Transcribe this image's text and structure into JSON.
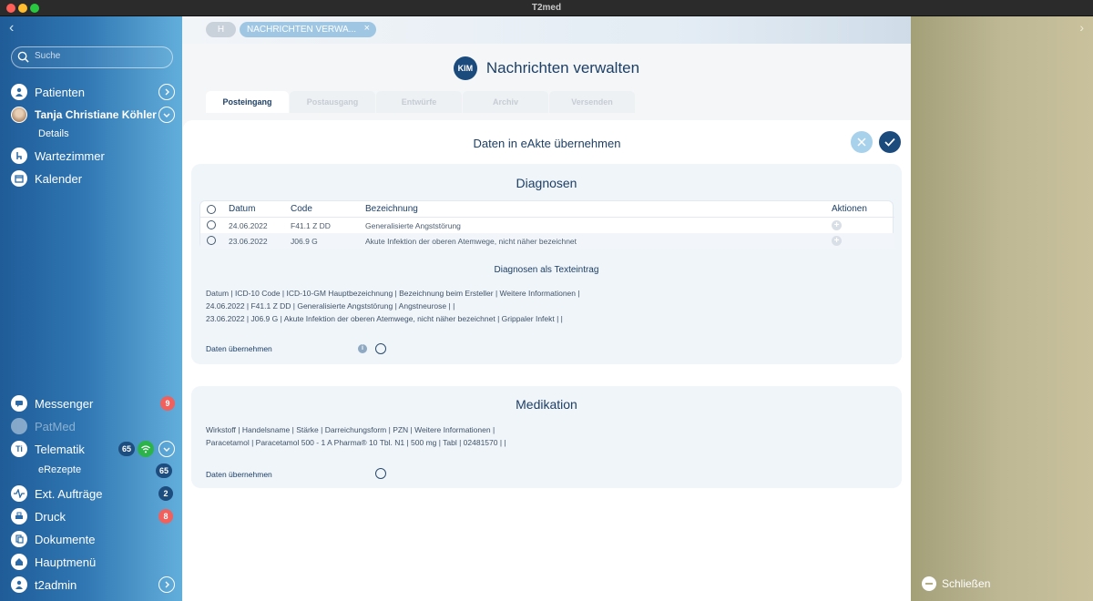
{
  "window": {
    "title": "T2med"
  },
  "sidebar": {
    "search_placeholder": "Suche",
    "items": {
      "patienten": {
        "label": "Patienten"
      },
      "patient": {
        "label": "Tanja Christiane Köhler"
      },
      "details": {
        "label": "Details"
      },
      "wartezimmer": {
        "label": "Wartezimmer"
      },
      "kalender": {
        "label": "Kalender"
      },
      "messenger": {
        "label": "Messenger",
        "badge": "9"
      },
      "patmed": {
        "label": "PatMed"
      },
      "telematik": {
        "label": "Telematik",
        "badge": "65"
      },
      "erezepte": {
        "label": "eRezepte",
        "badge": "65"
      },
      "auftraege": {
        "label": "Ext. Aufträge",
        "badge": "2"
      },
      "druck": {
        "label": "Druck",
        "badge": "8"
      },
      "dokumente": {
        "label": "Dokumente"
      },
      "hauptmenue": {
        "label": "Hauptmenü"
      },
      "user": {
        "label": "t2admin"
      }
    }
  },
  "top_tabs": {
    "home": "H",
    "active": "NACHRICHTEN VERWA..."
  },
  "header": {
    "logo": "KIM",
    "title": "Nachrichten verwalten"
  },
  "sub_tabs": [
    "Posteingang",
    "Postausgang",
    "Entwürfe",
    "Archiv",
    "Versenden"
  ],
  "dialog": {
    "title": "Daten in eAkte übernehmen",
    "diagnosen": {
      "title": "Diagnosen",
      "columns": [
        "Datum",
        "Code",
        "Bezeichnung",
        "Aktionen"
      ],
      "rows": [
        {
          "datum": "24.06.2022",
          "code": "F41.1 Z DD",
          "bezeichnung": "Generalisierte Angststörung"
        },
        {
          "datum": "23.06.2022",
          "code": "J06.9 G",
          "bezeichnung": "Akute Infektion der oberen Atemwege, nicht näher bezeichnet"
        }
      ],
      "text_heading": "Diagnosen als Texteintrag",
      "text_lines": [
        "Datum | ICD-10 Code | ICD-10-GM Hauptbezeichnung | Bezeichnung beim Ersteller | Weitere Informationen |",
        "24.06.2022 | F41.1 Z DD | Generalisierte Angststörung | Angstneurose |  |",
        "23.06.2022 | J06.9 G | Akute Infektion der oberen Atemwege, nicht näher bezeichnet | Grippaler Infekt |  |"
      ],
      "take_label": "Daten übernehmen"
    },
    "medikation": {
      "title": "Medikation",
      "text_lines": [
        "Wirkstoff | Handelsname | Stärke | Darreichungsform | PZN | Weitere Informationen |",
        "Paracetamol | Paracetamol 500 - 1 A Pharma® 10 Tbl. N1 | 500 mg | Tabl | 02481570 |  |"
      ],
      "take_label": "Daten übernehmen"
    }
  },
  "right_pane": {
    "close_label": "Schließen"
  },
  "colors": {
    "accent": "#1b4a7c",
    "sidebar": "#2f76b2",
    "badge_red": "#f0605d",
    "right_pane": "#beb895"
  }
}
